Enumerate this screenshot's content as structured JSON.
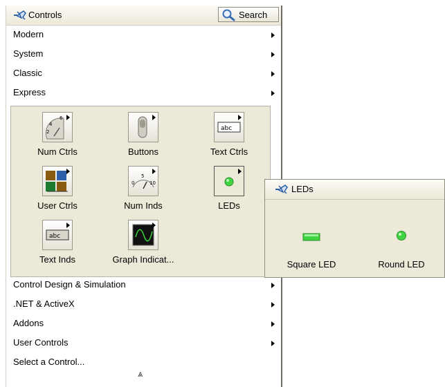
{
  "palette": {
    "title": "Controls",
    "search_label": "Search",
    "categories": [
      {
        "label": "Modern",
        "has_submenu": true
      },
      {
        "label": "System",
        "has_submenu": true
      },
      {
        "label": "Classic",
        "has_submenu": true
      },
      {
        "label": "Express",
        "has_submenu": true
      },
      {
        "label": "Control Design & Simulation",
        "has_submenu": true
      },
      {
        "label": ".NET & ActiveX",
        "has_submenu": true
      },
      {
        "label": "Addons",
        "has_submenu": true
      },
      {
        "label": "User Controls",
        "has_submenu": true
      },
      {
        "label": "Select a Control...",
        "has_submenu": false
      }
    ],
    "express_items": [
      {
        "label": "Num Ctrls",
        "icon": "numeric-control-knob-icon"
      },
      {
        "label": "Buttons",
        "icon": "toggle-switch-icon"
      },
      {
        "label": "Text Ctrls",
        "icon": "text-control-icon"
      },
      {
        "label": "User Ctrls",
        "icon": "user-controls-icon"
      },
      {
        "label": "Num Inds",
        "icon": "numeric-indicator-gauge-icon"
      },
      {
        "label": "LEDs",
        "icon": "led-icon"
      },
      {
        "label": "Text Inds",
        "icon": "text-indicator-icon"
      },
      {
        "label": "Graph Indicat...",
        "icon": "graph-indicator-icon"
      }
    ],
    "collapse_glyph": "⩓"
  },
  "leds_palette": {
    "title": "LEDs",
    "items": [
      {
        "label": "Square LED",
        "icon": "square-led-icon"
      },
      {
        "label": "Round LED",
        "icon": "round-led-icon"
      }
    ]
  },
  "colors": {
    "panel_bg": "#ece9d8",
    "led_green": "#3fd43f",
    "accent_blue": "#2d5fa8"
  }
}
